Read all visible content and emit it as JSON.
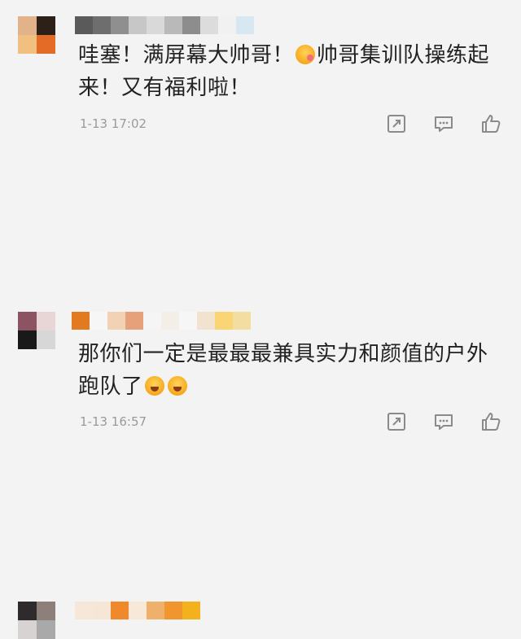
{
  "comments": [
    {
      "text_before_emoji": "哇塞！满屏幕大帅哥！",
      "text_after_emoji": "帅哥集训队操练起来！又有福利啦！",
      "time": "1-13 17:02",
      "emoji": "kiss-face-icon"
    },
    {
      "text_before_emoji": "那你们一定是最最最兼具实力和颜值的户外跑队了",
      "time": "1-13 16:57",
      "emoji": "excited-face-icon"
    }
  ],
  "colors": {
    "background": "#f3f3f3",
    "text": "#222222",
    "time": "#9a9a9a",
    "icon": "#8a8a8a"
  }
}
